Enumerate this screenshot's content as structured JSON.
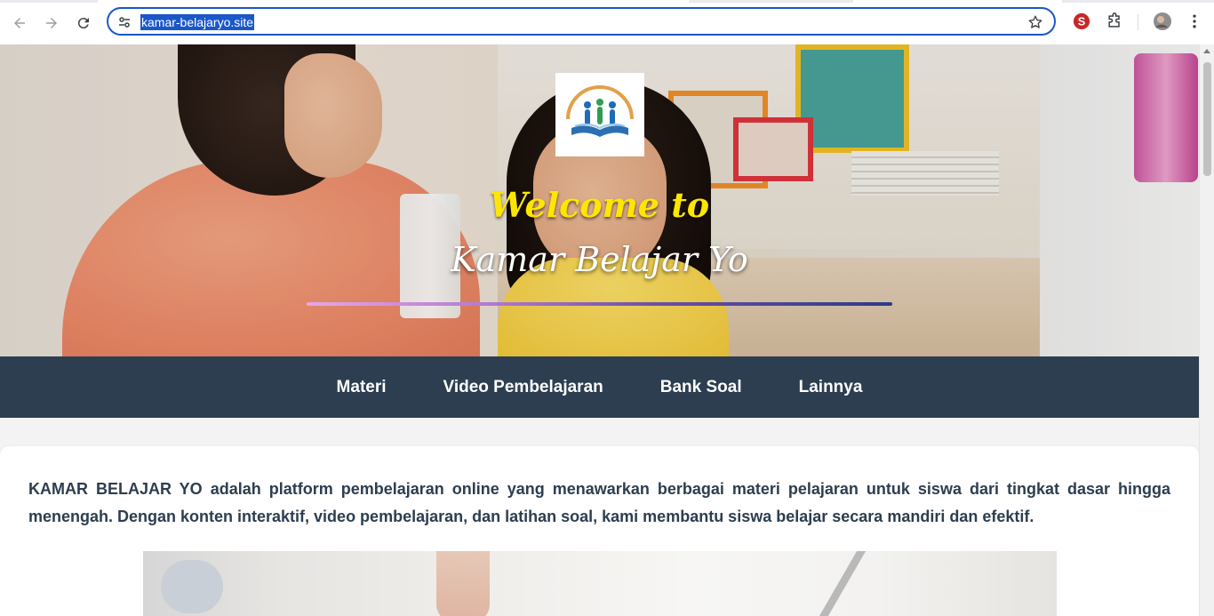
{
  "browser": {
    "url": "kamar-belajaryo.site",
    "icons": [
      "back-icon",
      "forward-icon",
      "reload-icon",
      "site-info-icon",
      "bookmark-star-icon",
      "extension-s-icon",
      "extensions-puzzle-icon",
      "profile-avatar",
      "more-menu-icon"
    ]
  },
  "hero": {
    "welcome": "Welcome to",
    "title": "Kamar Belajar Yo",
    "logo": "book-readers-logo"
  },
  "nav": {
    "items": [
      {
        "label": "Materi"
      },
      {
        "label": "Video Pembelajaran"
      },
      {
        "label": "Bank Soal"
      },
      {
        "label": "Lainnya"
      }
    ]
  },
  "intro": {
    "brand": "KAMAR BELAJAR YO",
    "text": " adalah platform pembelajaran online yang menawarkan berbagai materi pelajaran untuk siswa dari tingkat dasar hingga menengah. Dengan konten interaktif, video pembelajaran, dan latihan soal, kami membantu siswa belajar secara mandiri dan efektif."
  },
  "colors": {
    "navbar": "#2c3e50",
    "welcome": "#ffe600",
    "omnibox_border": "#1a57c9"
  }
}
